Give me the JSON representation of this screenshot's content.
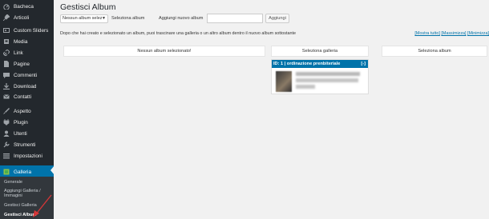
{
  "sidebar": {
    "items": [
      {
        "label": "Bacheca",
        "icon": "dashboard-icon",
        "active": false
      },
      {
        "label": "Articoli",
        "icon": "pin-icon",
        "active": false
      },
      {
        "label": "Custom Sliders",
        "icon": "slider-icon",
        "active": false
      },
      {
        "label": "Media",
        "icon": "media-icon",
        "active": false
      },
      {
        "label": "Link",
        "icon": "link-icon",
        "active": false
      },
      {
        "label": "Pagine",
        "icon": "page-icon",
        "active": false
      },
      {
        "label": "Commenti",
        "icon": "comment-icon",
        "active": false
      },
      {
        "label": "Download",
        "icon": "download-icon",
        "active": false
      },
      {
        "label": "Contatti",
        "icon": "mail-icon",
        "active": false
      },
      {
        "label": "Aspetto",
        "icon": "brush-icon",
        "active": false
      },
      {
        "label": "Plugin",
        "icon": "plugin-icon",
        "active": false
      },
      {
        "label": "Utenti",
        "icon": "users-icon",
        "active": false
      },
      {
        "label": "Strumenti",
        "icon": "tools-icon",
        "active": false
      },
      {
        "label": "Impostazioni",
        "icon": "settings-icon",
        "active": false
      },
      {
        "label": "Galleria",
        "icon": "gallery-icon",
        "active": true
      }
    ],
    "submenu": [
      {
        "label": "Generale",
        "current": false
      },
      {
        "label": "Aggiungi Galleria / Immagini",
        "current": false
      },
      {
        "label": "Gestisci Galleria",
        "current": false
      },
      {
        "label": "Gestisci Album",
        "current": true
      }
    ]
  },
  "page": {
    "title": "Gestisci Album",
    "select_value": "Nessun album selez",
    "select_label": "Seleziona album",
    "add_label": "Aggiungi nuovo album",
    "add_input_value": "",
    "add_button": "Aggiungi",
    "description": "Dopo che hai creato e selezionato un album, puoi trascinare una galleria o un altro album dentro il nuovo album sottostante",
    "view_links": [
      "[Mostra tutto]",
      "[Massimizza]",
      "[Minimizza]"
    ]
  },
  "columns": [
    {
      "label": "Nessun album selezionato!"
    },
    {
      "label": "Seleziona galleria"
    },
    {
      "label": "Seleziona album"
    }
  ],
  "gallery_card": {
    "header": "ID: 1 | ordinazione prenbiteriale",
    "toggle": "[-]"
  },
  "colors": {
    "sidebar_bg": "#23282d",
    "submenu_bg": "#32373c",
    "accent": "#0073aa",
    "arrow": "#d63638"
  }
}
